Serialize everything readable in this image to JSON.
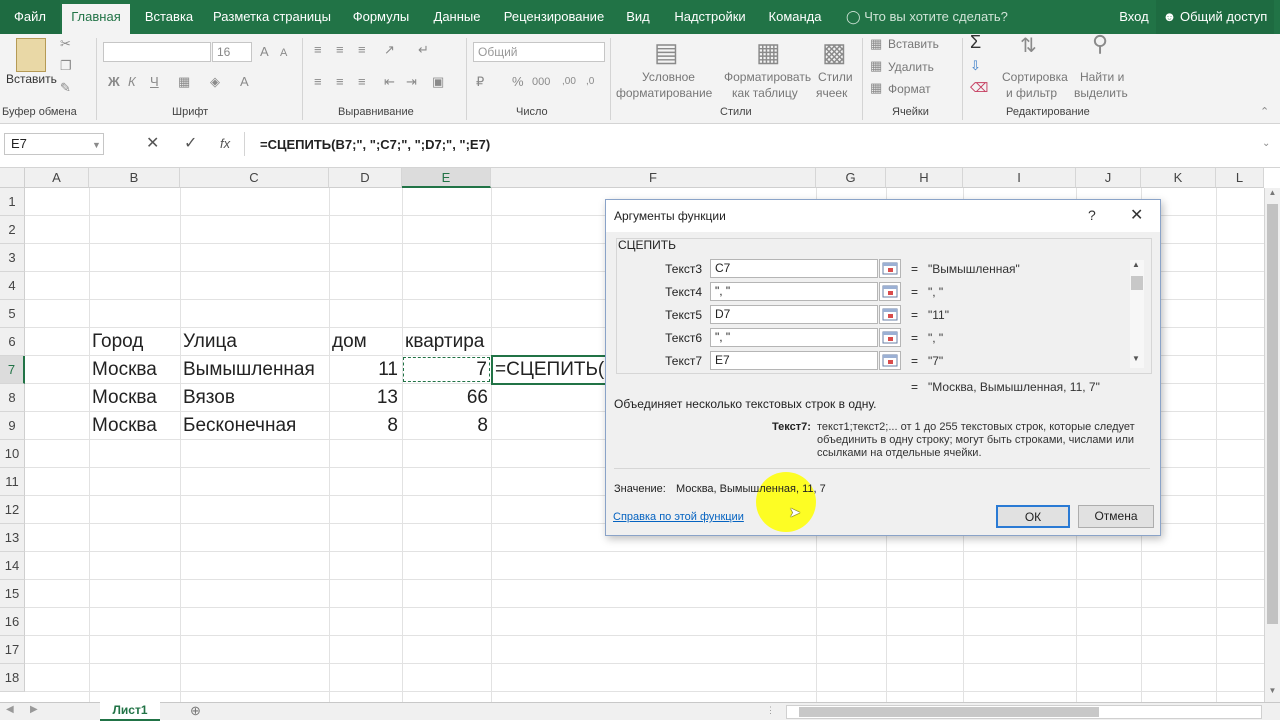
{
  "ribbon_tabs": [
    "Файл",
    "Главная",
    "Вставка",
    "Разметка страницы",
    "Формулы",
    "Данные",
    "Рецензирование",
    "Вид",
    "Надстройки",
    "Команда"
  ],
  "tell_me": "Что вы хотите сделать?",
  "signin": "Вход",
  "share": "Общий доступ",
  "ribbon": {
    "paste_label": "Вставить",
    "font_size": "16",
    "number_format": "Общий",
    "cond_format": [
      "Условное",
      "форматирование"
    ],
    "format_table": [
      "Форматировать",
      "как таблицу"
    ],
    "cell_styles": [
      "Стили",
      "ячеек"
    ],
    "cells_insert": "Вставить",
    "cells_delete": "Удалить",
    "cells_format": "Формат",
    "sort_filter": [
      "Сортировка",
      "и фильтр"
    ],
    "find_select": [
      "Найти и",
      "выделить"
    ],
    "groups": [
      "Буфер обмена",
      "Шрифт",
      "Выравнивание",
      "Число",
      "Стили",
      "Ячейки",
      "Редактирование"
    ]
  },
  "name_box": "E7",
  "formula": "=СЦЕПИТЬ(B7;\", \";C7;\", \";D7;\", \";E7)",
  "columns": [
    "A",
    "B",
    "C",
    "D",
    "E",
    "F",
    "G",
    "H",
    "I",
    "J",
    "K",
    "L"
  ],
  "rows": [
    "1",
    "2",
    "3",
    "4",
    "5",
    "6",
    "7",
    "8",
    "9",
    "10",
    "11",
    "12",
    "13",
    "14",
    "15",
    "16",
    "17",
    "18"
  ],
  "cells": {
    "B6": "Город",
    "C6": "Улица",
    "D6": "дом",
    "E6": "квартира",
    "B7": "Москва",
    "C7": "Вымышленная",
    "D7": "11",
    "E7": "7",
    "F7": "=СЦЕПИТЬ(B7",
    "B8": "Москва",
    "C8": "Вязов",
    "D8": "13",
    "E8": "66",
    "B9": "Москва",
    "C9": "Бесконечная",
    "D9": "8",
    "E9": "8"
  },
  "sheet_tab": "Лист1",
  "dialog": {
    "title": "Аргументы функции",
    "help_glyph": "?",
    "func_name": "СЦЕПИТЬ",
    "args": [
      {
        "label": "Текст3",
        "value": "C7",
        "result": "\"Вымышленная\""
      },
      {
        "label": "Текст4",
        "value": "\", \"",
        "result": "\", \""
      },
      {
        "label": "Текст5",
        "value": "D7",
        "result": "\"11\""
      },
      {
        "label": "Текст6",
        "value": "\", \"",
        "result": "\", \""
      },
      {
        "label": "Текст7",
        "value": "E7",
        "result": "\"7\""
      }
    ],
    "total_result": "\"Москва, Вымышленная, 11, 7\"",
    "description": "Объединяет несколько текстовых строк в одну.",
    "arg_desc_label": "Текст7:",
    "arg_desc": [
      "текст1;текст2;... от 1 до 255 текстовых строк, которые следует",
      "объединить в одну строку; могут быть строками, числами или",
      "ссылками на отдельные ячейки."
    ],
    "value_label": "Значение:",
    "value": "Москва, Вымышленная, 11, 7",
    "help_link": "Справка по этой функции",
    "ok": "ОК",
    "cancel": "Отмена"
  },
  "colors": {
    "excel_green": "#217346",
    "highlight": "#ffff00",
    "link": "#0563c1"
  }
}
